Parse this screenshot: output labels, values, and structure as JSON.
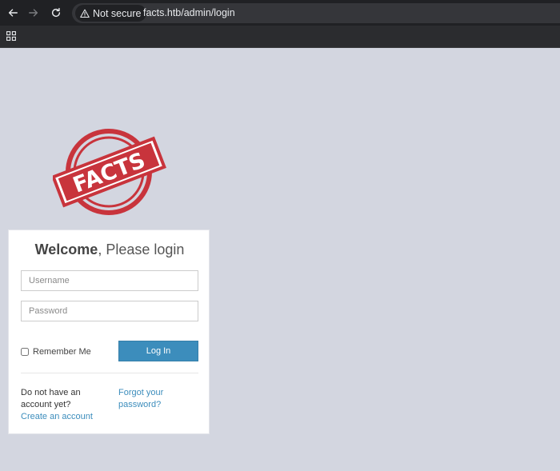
{
  "browser": {
    "security_label": "Not secure",
    "url": "facts.htb/admin/login"
  },
  "logo": {
    "text": "FACTS",
    "color": "#c8343c"
  },
  "login": {
    "title_bold": "Welcome",
    "title_rest": ", Please login",
    "username_placeholder": "Username",
    "password_placeholder": "Password",
    "remember_label": "Remember Me",
    "login_button": "Log In",
    "no_account_text": "Do not have an account yet?",
    "create_account_link": "Create an account",
    "forgot_password_link": "Forgot your password?"
  },
  "colors": {
    "page_bg": "#d3d6e0",
    "button_bg": "#3c8dbc",
    "link": "#3c8dbc"
  }
}
